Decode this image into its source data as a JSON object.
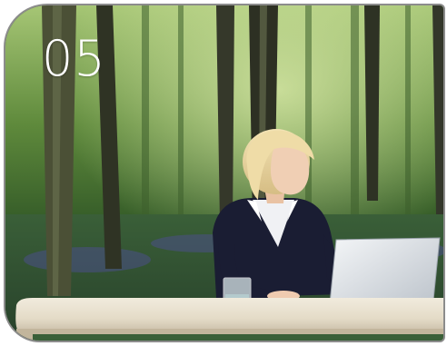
{
  "slide": {
    "number": "05",
    "scene": {
      "description_icon": "photo-icon",
      "colors": {
        "forest_dark": "#1f3a1a",
        "forest_light": "#6f9b4a",
        "desk": "#e9e2d2",
        "desk_edge": "#b9b09e",
        "frame_border": "#8c8c8c"
      }
    }
  }
}
